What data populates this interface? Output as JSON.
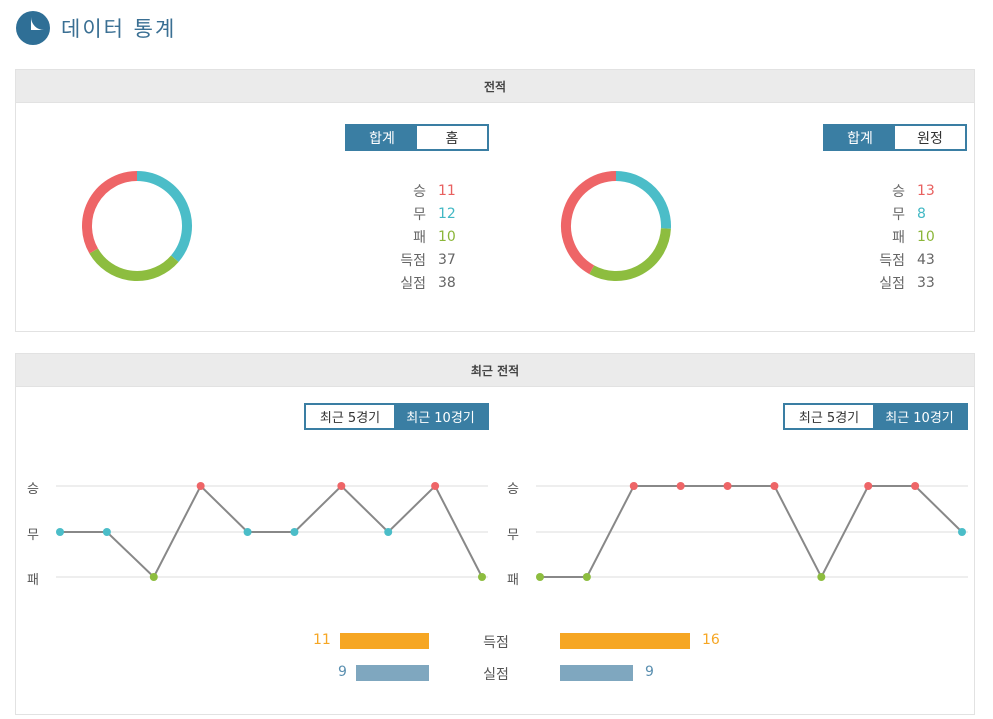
{
  "header": {
    "title": "데이터 통계",
    "icon": "pie-chart-icon"
  },
  "record": {
    "title": "전적",
    "home": {
      "tabs": [
        "합계",
        "홈"
      ],
      "active_tab": 0,
      "stats": [
        {
          "label": "승",
          "value": "11",
          "color": "#e8605f"
        },
        {
          "label": "무",
          "value": "12",
          "color": "#42b8c4"
        },
        {
          "label": "패",
          "value": "10",
          "color": "#8bb639"
        },
        {
          "label": "득점",
          "value": "37",
          "color": "#666666"
        },
        {
          "label": "실점",
          "value": "38",
          "color": "#666666"
        }
      ],
      "donut": [
        {
          "key": "무",
          "value": 12,
          "color": "#4bbdc8"
        },
        {
          "key": "패",
          "value": 10,
          "color": "#8dbd3f"
        },
        {
          "key": "승",
          "value": 11,
          "color": "#ee6567"
        }
      ]
    },
    "away": {
      "tabs": [
        "합계",
        "원정"
      ],
      "active_tab": 0,
      "stats": [
        {
          "label": "승",
          "value": "13",
          "color": "#e8605f"
        },
        {
          "label": "무",
          "value": "8",
          "color": "#42b8c4"
        },
        {
          "label": "패",
          "value": "10",
          "color": "#8bb639"
        },
        {
          "label": "득점",
          "value": "43",
          "color": "#666666"
        },
        {
          "label": "실점",
          "value": "33",
          "color": "#666666"
        }
      ],
      "donut": [
        {
          "key": "무",
          "value": 8,
          "color": "#4bbdc8"
        },
        {
          "key": "패",
          "value": 10,
          "color": "#8dbd3f"
        },
        {
          "key": "승",
          "value": 13,
          "color": "#ee6567"
        }
      ]
    }
  },
  "recent": {
    "title": "최근 전적",
    "tabs": [
      "최근 5경기",
      "최근 10경기"
    ],
    "active_tab": 1,
    "y_labels": [
      "승",
      "무",
      "패"
    ],
    "colors": {
      "승": "#ee6567",
      "무": "#4bbdc8",
      "패": "#8dbd3f"
    },
    "home_results": [
      "무",
      "무",
      "패",
      "승",
      "무",
      "무",
      "승",
      "무",
      "승",
      "패"
    ],
    "away_results": [
      "패",
      "패",
      "승",
      "승",
      "승",
      "승",
      "패",
      "승",
      "승",
      "무"
    ],
    "bars": [
      {
        "label": "득점",
        "home": 11,
        "away": 16,
        "home_color": "#f6a623",
        "away_color": "#f6a623"
      },
      {
        "label": "실점",
        "home": 9,
        "away": 9,
        "home_color": "#7fa7bf",
        "away_color": "#7fa7bf"
      }
    ]
  },
  "chart_data": [
    {
      "type": "pie",
      "labels": [
        "승",
        "무",
        "패"
      ],
      "values": [
        11,
        12,
        10
      ]
    },
    {
      "type": "pie",
      "labels": [
        "승",
        "무",
        "패"
      ],
      "values": [
        13,
        8,
        10
      ]
    },
    {
      "type": "line",
      "x": [
        1,
        2,
        3,
        4,
        5,
        6,
        7,
        8,
        9,
        10
      ],
      "categories": [
        "승",
        "무",
        "패"
      ],
      "values": [
        "무",
        "무",
        "패",
        "승",
        "무",
        "무",
        "승",
        "무",
        "승",
        "패"
      ]
    },
    {
      "type": "line",
      "x": [
        1,
        2,
        3,
        4,
        5,
        6,
        7,
        8,
        9,
        10
      ],
      "categories": [
        "승",
        "무",
        "패"
      ],
      "values": [
        "패",
        "패",
        "승",
        "승",
        "승",
        "승",
        "패",
        "승",
        "승",
        "무"
      ]
    },
    {
      "type": "bar",
      "categories": [
        "득점",
        "실점"
      ],
      "series": [
        {
          "values": [
            11,
            9
          ]
        },
        {
          "values": [
            16,
            9
          ]
        }
      ]
    }
  ]
}
